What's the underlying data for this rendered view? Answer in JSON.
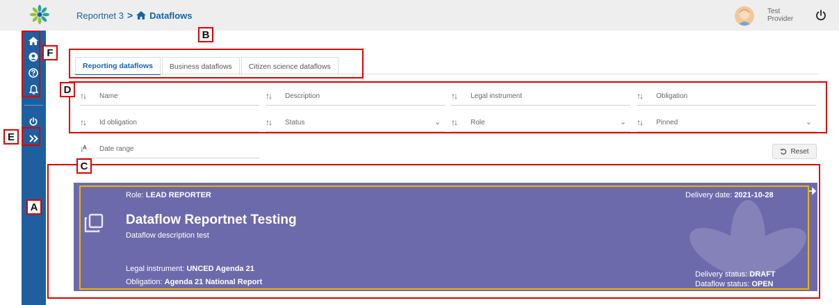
{
  "header": {
    "breadcrumb_root": "Reportnet 3",
    "breadcrumb_separator": ">",
    "breadcrumb_current": "Dataflows",
    "user_first": "Test",
    "user_second": "Provider"
  },
  "tabs": [
    {
      "label": "Reporting dataflows",
      "active": true
    },
    {
      "label": "Business dataflows",
      "active": false
    },
    {
      "label": "Citizen science dataflows",
      "active": false
    }
  ],
  "filters": {
    "name": "Name",
    "description": "Description",
    "legal_instrument": "Legal instrument",
    "obligation": "Obligation",
    "id_obligation": "Id obligation",
    "status": "Status",
    "role": "Role",
    "pinned": "Pinned",
    "date_range": "Date range"
  },
  "reset_label": "Reset",
  "card": {
    "role_prefix": "Role: ",
    "role": "LEAD REPORTER",
    "delivery_date_prefix": "Delivery date: ",
    "delivery_date": "2021-10-28",
    "title": "Dataflow Reportnet Testing",
    "description": "Dataflow description test",
    "legal_instrument_prefix": "Legal instrument: ",
    "legal_instrument": "UNCED Agenda 21",
    "obligation_prefix": "Obligation: ",
    "obligation": "Agenda 21 National Report",
    "delivery_status_prefix": "Delivery status: ",
    "delivery_status": "DRAFT",
    "dataflow_status_prefix": "Dataflow status: ",
    "dataflow_status": "OPEN"
  },
  "annotations": {
    "a": "A",
    "b": "B",
    "c": "C",
    "d": "D",
    "e": "E",
    "f": "F"
  },
  "colors": {
    "sidebar": "#1f5f9e",
    "accent": "#1565a6",
    "card": "#6d6aab",
    "annotation_red": "#e00000",
    "highlight_yellow": "#f0b400"
  }
}
